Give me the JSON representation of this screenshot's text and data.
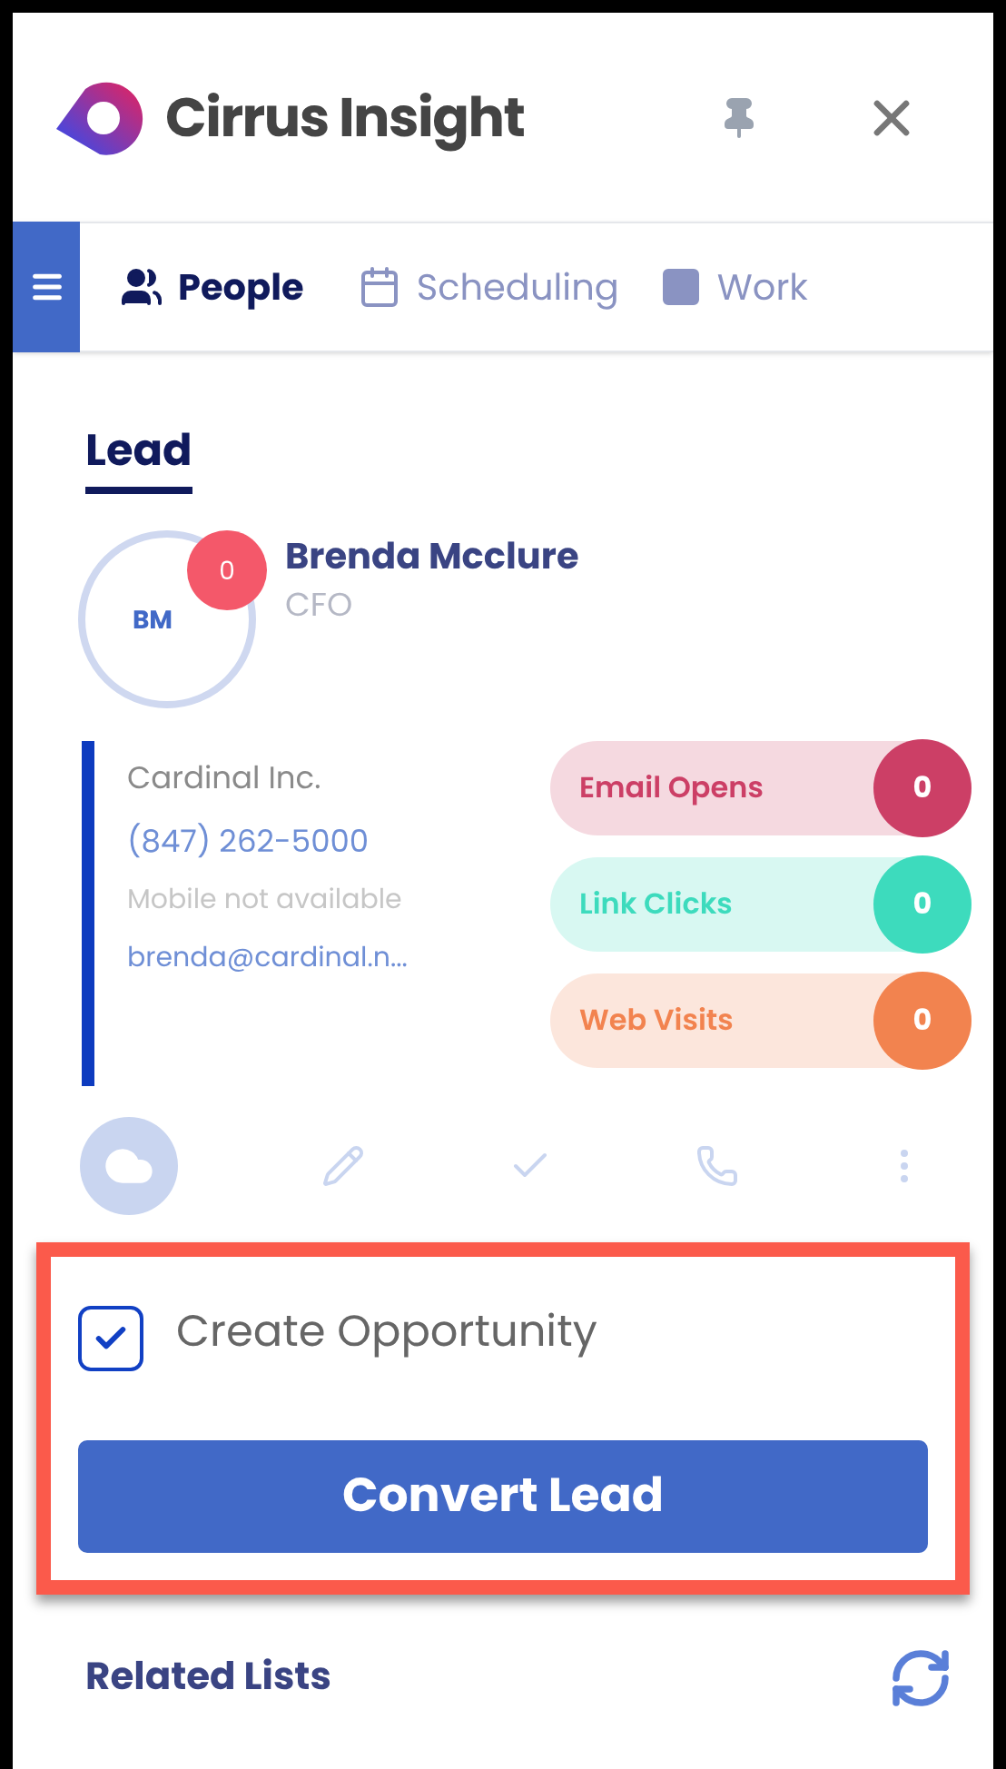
{
  "header": {
    "title": "Cirrus Insight"
  },
  "tabs": [
    {
      "label": "People",
      "selected": true,
      "kind": "people"
    },
    {
      "label": "Scheduling",
      "selected": false,
      "kind": "calendar"
    },
    {
      "label": "Work",
      "selected": false,
      "kind": "square"
    }
  ],
  "section_title": "Lead",
  "contact": {
    "initials": "BM",
    "badge": "0",
    "name": "Brenda Mcclure",
    "role": "CFO",
    "company": "Cardinal Inc.",
    "phone": "(847) 262-5000",
    "mobile": "Mobile not available",
    "email": "brenda@cardinal.n..."
  },
  "stats": [
    {
      "label": "Email Opens",
      "count": "0",
      "color": "#cc3f66"
    },
    {
      "label": "Link Clicks",
      "count": "0",
      "color": "#3ddbbd"
    },
    {
      "label": "Web Visits",
      "count": "0",
      "color": "#f2834f"
    }
  ],
  "convert": {
    "checkbox_label": "Create Opportunity",
    "checked": true,
    "button": "Convert Lead"
  },
  "related": {
    "title": "Related Lists"
  }
}
